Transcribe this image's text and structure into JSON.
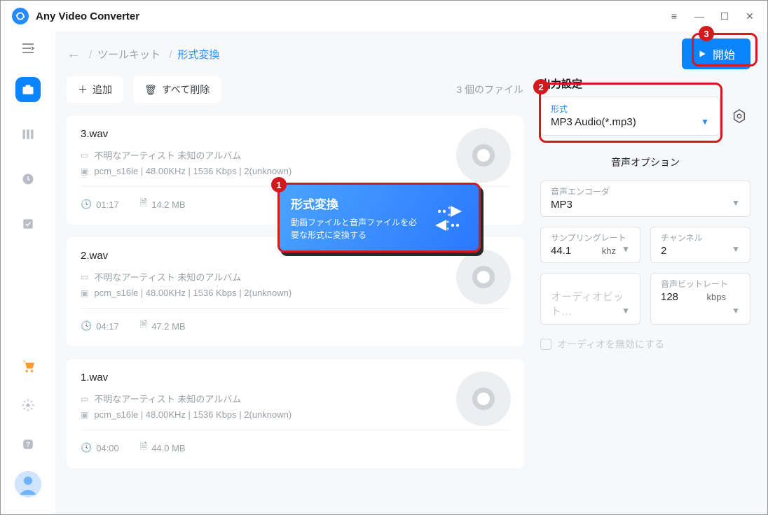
{
  "app": {
    "title": "Any Video Converter"
  },
  "breadcrumb": {
    "toolkit": "ツールキット",
    "current": "形式変換"
  },
  "start_button": "開始",
  "toolbar": {
    "add": "追加",
    "delete_all": "すべて削除",
    "file_count": "3 個のファイル"
  },
  "files": [
    {
      "name": "3.wav",
      "artist": "不明なアーティスト 未知のアルバム",
      "codec": "pcm_s16le | 48.00KHz | 1536 Kbps | 2(unknown)",
      "duration": "01:17",
      "size": "14.2 MB"
    },
    {
      "name": "2.wav",
      "artist": "不明なアーティスト 未知のアルバム",
      "codec": "pcm_s16le | 48.00KHz | 1536 Kbps | 2(unknown)",
      "duration": "04:17",
      "size": "47.2 MB"
    },
    {
      "name": "1.wav",
      "artist": "不明なアーティスト 未知のアルバム",
      "codec": "pcm_s16le | 48.00KHz | 1536 Kbps | 2(unknown)",
      "duration": "04:00",
      "size": "44.0 MB"
    }
  ],
  "settings": {
    "heading": "出力設定",
    "format_label": "形式",
    "format_value": "MP3 Audio(*.mp3)",
    "audio_options": "音声オプション",
    "encoder_label": "音声エンコーダ",
    "encoder_value": "MP3",
    "samplerate_label": "サンプリングレート",
    "samplerate_value": "44.1",
    "samplerate_unit": "khz",
    "channel_label": "チャンネル",
    "channel_value": "2",
    "audiobit_label": "オーディオビット…",
    "bitrate_label": "音声ビットレート",
    "bitrate_value": "128",
    "bitrate_unit": "kbps",
    "disable_audio": "オーディオを無効にする"
  },
  "popup": {
    "title": "形式変換",
    "desc": "動画ファイルと音声ファイルを必要な形式に変換する"
  },
  "badges": {
    "b1": "1",
    "b2": "2",
    "b3": "3"
  }
}
